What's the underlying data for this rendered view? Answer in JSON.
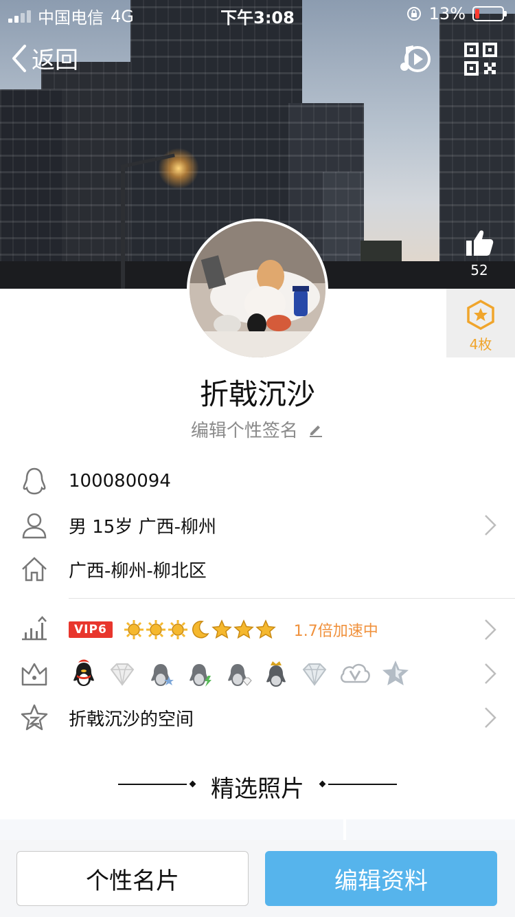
{
  "status_bar": {
    "carrier": "中国电信",
    "network": "4G",
    "time": "下午3:08",
    "battery": "13%",
    "battery_level": 0.13
  },
  "nav": {
    "back_label": "返回",
    "icons": [
      "music-play-icon",
      "qr-code-icon"
    ]
  },
  "like": {
    "count": "52",
    "icon": "thumbs-up-icon"
  },
  "medal": {
    "label": "4枚",
    "icon": "hexagon-star-icon"
  },
  "profile": {
    "name": "折戟沉沙",
    "signature_placeholder": "编辑个性签名"
  },
  "info": {
    "qq_number": "100080094",
    "basic": "男 15岁 广西-柳州",
    "hometown": "广西-柳州-柳北区",
    "vip_label": "VIP6",
    "speed_text": "1.7倍加速中",
    "space": "折戟沉沙的空间"
  },
  "level_icons": [
    "sun",
    "sun",
    "sun",
    "moon",
    "star",
    "star",
    "star"
  ],
  "badges": [
    "qq-penguin-red",
    "diamond-gray",
    "penguin-gray-star",
    "penguin-gray-bolt",
    "penguin-gray-diamond",
    "penguin-crown",
    "diamond-gray-2",
    "cloud-v",
    "star-gray"
  ],
  "section": {
    "photos_title": "精选照片"
  },
  "buttons": {
    "profile_card": "个性名片",
    "edit_profile": "编辑资料"
  },
  "colors": {
    "vip_red": "#e8362d",
    "accent_blue": "#56b4ec",
    "speed_orange": "#f0913c",
    "medal_gold": "#f0a52c"
  }
}
